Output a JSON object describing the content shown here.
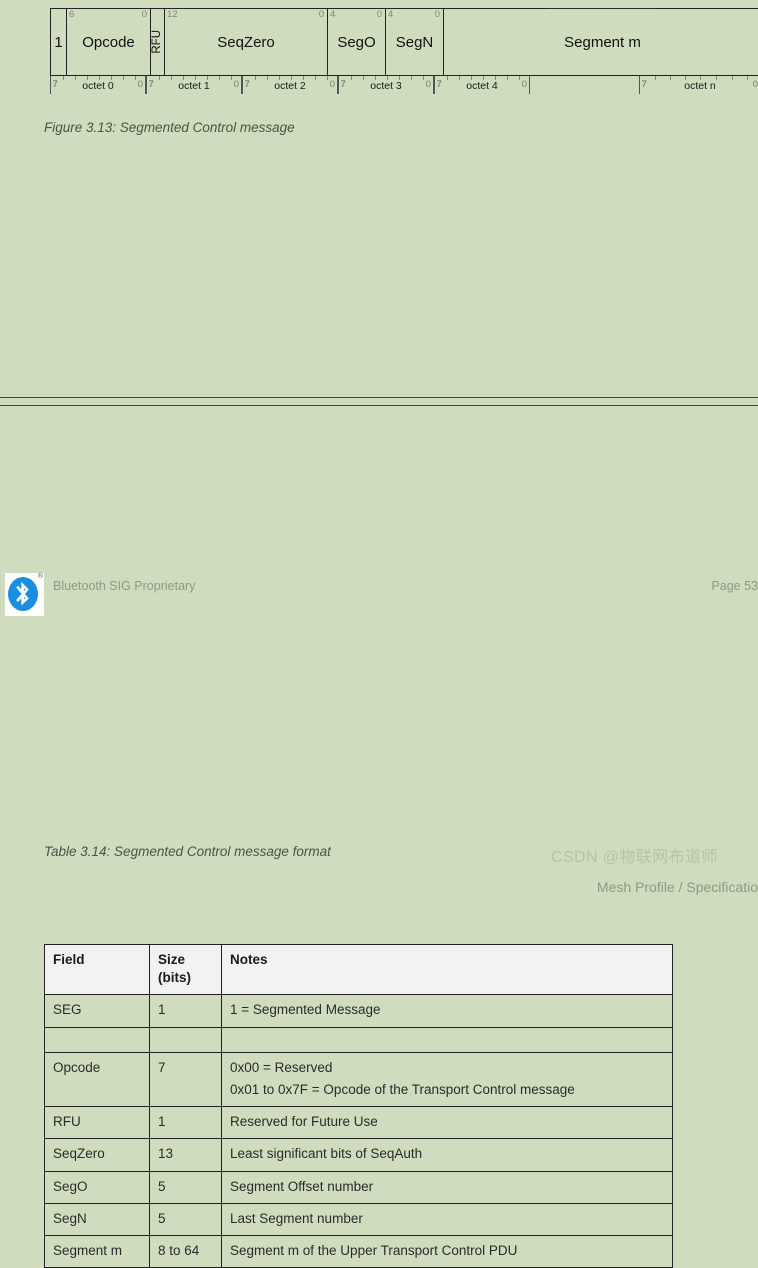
{
  "figure": {
    "caption": "Figure 3.13: Segmented Control message",
    "fields": [
      {
        "label": "1",
        "top_left_bit": "",
        "top_right_bit": "",
        "vertical": false
      },
      {
        "label": "Opcode",
        "top_left_bit": "6",
        "top_right_bit": "0",
        "vertical": false
      },
      {
        "label": "RFU",
        "top_left_bit": "",
        "top_right_bit": "",
        "vertical": true
      },
      {
        "label": "SeqZero",
        "top_left_bit": "12",
        "top_right_bit": "0",
        "vertical": false
      },
      {
        "label": "SegO",
        "top_left_bit": "4",
        "top_right_bit": "0",
        "vertical": false
      },
      {
        "label": "SegN",
        "top_left_bit": "4",
        "top_right_bit": "0",
        "vertical": false
      },
      {
        "label": "Segment m",
        "top_left_bit": "",
        "top_right_bit": "",
        "vertical": false
      }
    ],
    "octets": [
      {
        "name": "octet 0",
        "left_bit": "7",
        "right_bit": "0"
      },
      {
        "name": "octet 1",
        "left_bit": "7",
        "right_bit": "0"
      },
      {
        "name": "octet 2",
        "left_bit": "7",
        "right_bit": "0"
      },
      {
        "name": "octet 3",
        "left_bit": "7",
        "right_bit": "0"
      },
      {
        "name": "octet 4",
        "left_bit": "7",
        "right_bit": "0"
      },
      {
        "name": "octet n",
        "left_bit": "7",
        "right_bit": "0"
      }
    ]
  },
  "footer": {
    "proprietary_text": "Bluetooth SIG Proprietary",
    "page_number": "Page 53",
    "logo_name": "bluetooth-logo",
    "registered_mark": "®"
  },
  "header": {
    "breadcrumb": "Mesh Profile  /  Specificatio"
  },
  "table": {
    "caption": "Table 3.14: Segmented Control message format",
    "columns": [
      "Field",
      "Size\n(bits)",
      "Notes"
    ],
    "column_header_field": "Field",
    "column_header_size_line1": "Size",
    "column_header_size_line2": "(bits)",
    "column_header_notes": "Notes",
    "rows": [
      {
        "field": "SEG",
        "size": "1",
        "notes": [
          "1 = Segmented Message"
        ]
      },
      {
        "field": "",
        "size": "",
        "notes": [
          ""
        ]
      },
      {
        "field": "Opcode",
        "size": "7",
        "notes": [
          "0x00 = Reserved",
          "0x01 to 0x7F = Opcode of the Transport Control message"
        ]
      },
      {
        "field": "RFU",
        "size": "1",
        "notes": [
          "Reserved for Future Use"
        ]
      },
      {
        "field": "SeqZero",
        "size": "13",
        "notes": [
          "Least significant bits of SeqAuth"
        ]
      },
      {
        "field": "SegO",
        "size": "5",
        "notes": [
          "Segment Offset number"
        ]
      },
      {
        "field": "SegN",
        "size": "5",
        "notes": [
          "Last Segment number"
        ]
      },
      {
        "field": "Segment m",
        "size": "8 to 64",
        "notes": [
          "Segment m of the Upper Transport Control PDU"
        ]
      }
    ]
  },
  "watermark": {
    "text": "CSDN @物联网布道师"
  },
  "colors": {
    "page_background": "#cfdcbd",
    "ink": "#222222",
    "muted": "#8e9a85",
    "table_header_bg": "#f2f2f2",
    "bluetooth_blue": "#1a8fe0",
    "watermark": "#b7c4a6"
  }
}
